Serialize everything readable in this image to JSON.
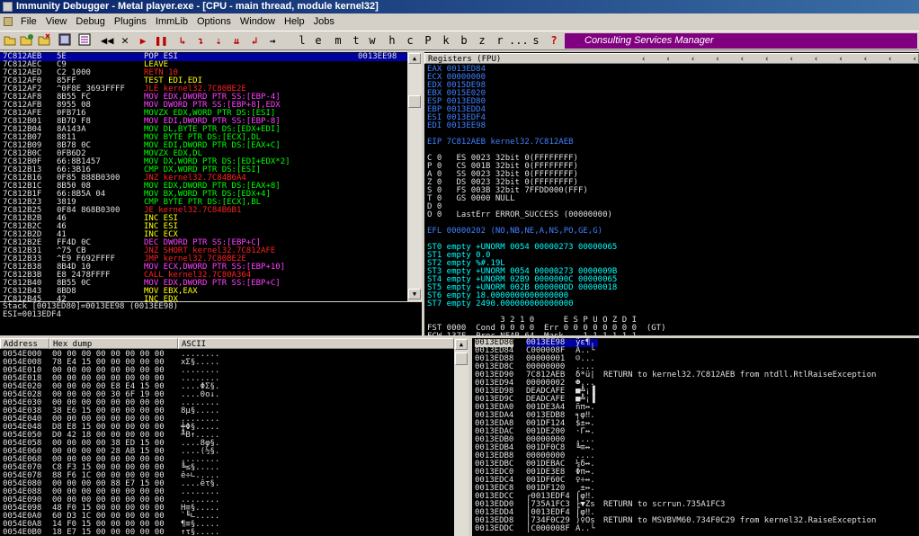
{
  "title": "Immunity Debugger - Metal player.exe - [CPU - main thread, module kernel32]",
  "menu": [
    "File",
    "View",
    "Debug",
    "Plugins",
    "ImmLib",
    "Options",
    "Window",
    "Help",
    "Jobs"
  ],
  "toolbar_letters": [
    "l",
    "e",
    "m",
    "t",
    "w",
    "h",
    "c",
    "P",
    "k",
    "b",
    "z",
    "r",
    "...",
    "s",
    "?"
  ],
  "consulting": "Consulting Services Manager",
  "disasm": [
    {
      "a": "7C812AEB",
      "h": "5E",
      "i": "POP ESI",
      "c": "w",
      "sel": true,
      "r": "0013EE98"
    },
    {
      "a": "7C812AEC",
      "h": "C9",
      "i": "LEAVE",
      "c": "y"
    },
    {
      "a": "7C812AED",
      "h": "C2 1000",
      "i": "RETN 10",
      "c": "r"
    },
    {
      "a": "7C812AF0",
      "h": "85FF",
      "i": "TEST EDI,EDI",
      "c": "y"
    },
    {
      "a": "7C812AF2",
      "h": "^0F8E 3693FFFF",
      "i": "JLE kernel32.7C80BE2E",
      "c": "r"
    },
    {
      "a": "7C812AF8",
      "h": "8B55 FC",
      "i": "MOV EDX,DWORD PTR SS:[EBP-4]",
      "c": "m"
    },
    {
      "a": "7C812AFB",
      "h": "8955 08",
      "i": "MOV DWORD PTR SS:[EBP+8],EDX",
      "c": "m"
    },
    {
      "a": "7C812AFE",
      "h": "0FB716",
      "i": "MOVZX EDX,WORD PTR DS:[ESI]",
      "c": "g"
    },
    {
      "a": "7C812B01",
      "h": "8B7D F8",
      "i": "MOV EDI,DWORD PTR SS:[EBP-8]",
      "c": "m"
    },
    {
      "a": "7C812B04",
      "h": "8A143A",
      "i": "MOV DL,BYTE PTR DS:[EDX+EDI]",
      "c": "g"
    },
    {
      "a": "7C812B07",
      "h": "8811",
      "i": "MOV BYTE PTR DS:[ECX],DL",
      "c": "g"
    },
    {
      "a": "7C812B09",
      "h": "8B78 0C",
      "i": "MOV EDI,DWORD PTR DS:[EAX+C]",
      "c": "g"
    },
    {
      "a": "7C812B0C",
      "h": "0FB6D2",
      "i": "MOVZX EDX,DL",
      "c": "g"
    },
    {
      "a": "7C812B0F",
      "h": "66:8B1457",
      "i": "MOV DX,WORD PTR DS:[EDI+EDX*2]",
      "c": "g"
    },
    {
      "a": "7C812B13",
      "h": "66:3B16",
      "i": "CMP DX,WORD PTR DS:[ESI]",
      "c": "g"
    },
    {
      "a": "7C812B16",
      "h": "0F85 888B0300",
      "i": "JNZ kernel32.7C84B6A4",
      "c": "r"
    },
    {
      "a": "7C812B1C",
      "h": "8B50 08",
      "i": "MOV EDX,DWORD PTR DS:[EAX+8]",
      "c": "g"
    },
    {
      "a": "7C812B1F",
      "h": "66:8B5A 04",
      "i": "MOV BX,WORD PTR DS:[EDX+4]",
      "c": "g"
    },
    {
      "a": "7C812B23",
      "h": "3819",
      "i": "CMP BYTE PTR DS:[ECX],BL",
      "c": "g"
    },
    {
      "a": "7C812B25",
      "h": "0F84 868B0300",
      "i": "JE kernel32.7C84B6B1",
      "c": "r"
    },
    {
      "a": "7C812B2B",
      "h": "46",
      "i": "INC ESI",
      "c": "y"
    },
    {
      "a": "7C812B2C",
      "h": "46",
      "i": "INC ESI",
      "c": "y"
    },
    {
      "a": "7C812B2D",
      "h": "41",
      "i": "INC ECX",
      "c": "y"
    },
    {
      "a": "7C812B2E",
      "h": "FF4D 0C",
      "i": "DEC DWORD PTR SS:[EBP+C]",
      "c": "m"
    },
    {
      "a": "7C812B31",
      "h": "^75 CB",
      "i": "JNZ SHORT kernel32.7C812AFE",
      "c": "r"
    },
    {
      "a": "7C812B33",
      "h": "^E9 F692FFFF",
      "i": "JMP kernel32.7C80BE2E",
      "c": "r"
    },
    {
      "a": "7C812B38",
      "h": "8B4D 10",
      "i": "MOV ECX,DWORD PTR SS:[EBP+10]",
      "c": "m"
    },
    {
      "a": "7C812B3B",
      "h": "E8 2478FFFF",
      "i": "CALL kernel32.7C80A364",
      "c": "r"
    },
    {
      "a": "7C812B40",
      "h": "8B55 0C",
      "i": "MOV EDX,DWORD PTR SS:[EBP+C]",
      "c": "m"
    },
    {
      "a": "7C812B43",
      "h": "8BD8",
      "i": "MOV EBX,EAX",
      "c": "y"
    },
    {
      "a": "7C812B45",
      "h": "42",
      "i": "INC EDX",
      "c": "y"
    }
  ],
  "info": [
    "Stack [0013ED80]=0013EE98 (0013EE98)",
    "ESI=0013EDF4"
  ],
  "registers": {
    "title": "Registers (FPU)",
    "lines": [
      "EAX 0013ED84",
      "ECX 00000000",
      "EDX 0015DE98",
      "EBX 0015E020",
      "ESP 0013ED80",
      "EBP 0013EDD4",
      "ESI 0013EDF4",
      "EDI 0013EE98",
      "",
      "EIP 7C812AEB kernel32.7C812AEB",
      "",
      "C 0   ES 0023 32bit 0(FFFFFFFF)",
      "P 0   CS 001B 32bit 0(FFFFFFFF)",
      "A 0   SS 0023 32bit 0(FFFFFFFF)",
      "Z 0   DS 0023 32bit 0(FFFFFFFF)",
      "S 0   FS 003B 32bit 7FFDD000(FFF)",
      "T 0   GS 0000 NULL",
      "D 0",
      "O 0   LastErr ERROR_SUCCESS (00000000)",
      "",
      "EFL 00000202 (NO,NB,NE,A,NS,PO,GE,G)",
      "",
      "ST0 empty +UNORM 0054 00000273 00000065",
      "ST1 empty 0.0",
      "ST2 empty %#.19L",
      "ST3 empty +UNORM 0054 00000273 0000009B",
      "ST4 empty +UNORM 02B9 0000000C 00000065",
      "ST5 empty +UNORM 002B 000000DD 00000018",
      "ST6 empty 18.0000000000000000",
      "ST7 empty 2490.000000000000000",
      "",
      "               3 2 1 0      E S P U O Z D I",
      "FST 0000  Cond 0 0 0 0  Err 0 0 0 0 0 0 0 0  (GT)",
      "FCW 137F  Prec NEAR,64  Mask    1 1 1 1 1 1"
    ]
  },
  "dump_headers": [
    "Address",
    "Hex dump",
    "ASCII"
  ],
  "dump": [
    [
      "0054E000",
      "00 00 00 00 00 00 00 00",
      "........"
    ],
    [
      "0054E008",
      "78 E4 15 00 00 00 00 00",
      "xΣ§....."
    ],
    [
      "0054E010",
      "00 00 00 00 00 00 00 00",
      "........"
    ],
    [
      "0054E018",
      "00 00 00 00 00 00 00 00",
      "........"
    ],
    [
      "0054E020",
      "00 00 00 00 E8 E4 15 00",
      "....ΦΣ§."
    ],
    [
      "0054E028",
      "00 00 00 00 30 6F 19 00",
      "....0o↓."
    ],
    [
      "0054E030",
      "00 00 00 00 00 00 00 00",
      "........"
    ],
    [
      "0054E038",
      "38 E6 15 00 00 00 00 00",
      "8µ§....."
    ],
    [
      "0054E040",
      "00 00 00 00 00 00 00 00",
      "........"
    ],
    [
      "0054E048",
      "D8 E8 15 00 00 00 00 00",
      "╪Φ§....."
    ],
    [
      "0054E050",
      "D0 42 18 00 00 00 00 00",
      "╨B↑....."
    ],
    [
      "0054E058",
      "00 00 00 00 38 ED 15 00",
      "....8φ§."
    ],
    [
      "0054E060",
      "00 00 00 00 28 AB 15 00",
      "....(½§."
    ],
    [
      "0054E068",
      "00 00 00 00 00 00 00 00",
      "........"
    ],
    [
      "0054E070",
      "C8 F3 15 00 00 00 00 00",
      "╚≤§....."
    ],
    [
      "0054E078",
      "88 F6 1C 00 00 00 00 00",
      "ê÷∟....."
    ],
    [
      "0054E080",
      "00 00 00 00 88 E7 15 00",
      "....êτ§."
    ],
    [
      "0054E088",
      "00 00 00 00 00 00 00 00",
      "........"
    ],
    [
      "0054E090",
      "00 00 00 00 00 00 00 00",
      "........"
    ],
    [
      "0054E098",
      "48 F0 15 00 00 00 00 00",
      "H≡§....."
    ],
    [
      "0054E0A0",
      "60 D3 1C 00 00 00 00 00",
      "`╙∟....."
    ],
    [
      "0054E0A8",
      "14 F0 15 00 00 00 00 00",
      "¶≡§....."
    ],
    [
      "0054E0B0",
      "18 E7 15 00 00 00 00 00",
      "↑τ§....."
    ]
  ],
  "stack": [
    [
      "0013ED80",
      "0013EE98",
      "ÿε¶.",
      ""
    ],
    [
      "0013ED84",
      "C000008F",
      "A..└",
      ""
    ],
    [
      "0013ED88",
      "00000001",
      "☺...",
      ""
    ],
    [
      "0013ED8C",
      "00000000",
      "....",
      ""
    ],
    [
      "0013ED90",
      "7C812AEB",
      "δ*ü|",
      "RETURN to kernel32.7C812AEB from ntdll.RtlRaiseException"
    ],
    [
      "0013ED94",
      "00000002",
      "☻...",
      ""
    ],
    [
      "0013ED98",
      "DEADCAFE",
      "■╩¡▐",
      ""
    ],
    [
      "0013ED9C",
      "DEADCAFE",
      "■╩¡▐",
      ""
    ],
    [
      "0013EDA0",
      "001DE3A4",
      "ñπ↔.",
      ""
    ],
    [
      "0013EDA4",
      "0013EDB8",
      "╕φ‼.",
      ""
    ],
    [
      "0013EDA8",
      "001DF124",
      "$±↔.",
      ""
    ],
    [
      "0013EDAC",
      "001DE200",
      "·Γ↔.",
      ""
    ],
    [
      "0013EDB0",
      "00000000",
      "....",
      ""
    ],
    [
      "0013EDB4",
      "001DF0C8",
      "╚≡↔.",
      ""
    ],
    [
      "0013EDB8",
      "00000000",
      "....",
      ""
    ],
    [
      "0013EDBC",
      "001DEBAC",
      "¼δ↔.",
      ""
    ],
    [
      "0013EDC0",
      "001DE3E8",
      "Φπ↔.",
      ""
    ],
    [
      "0013EDC4",
      "001DF60C",
      "♀÷↔.",
      ""
    ],
    [
      "0013EDC8",
      "001DF120",
      " ±↔.",
      ""
    ],
    [
      "0013EDCC",
      "┌0013EDF4",
      "⌠φ‼.",
      ""
    ],
    [
      "0013EDD0",
      "│735A1FC3",
      "├▼Zs",
      "RETURN to scrrun.735A1FC3"
    ],
    [
      "0013EDD4",
      "│0013EDF4",
      "⌠φ‼.",
      ""
    ],
    [
      "0013EDD8",
      "│734F0C29",
      ")♀Os",
      "RETURN to MSVBVM60.734F0C29 from kernel32.RaiseException"
    ],
    [
      "0013EDDC",
      "│C000008F",
      "A..└",
      ""
    ]
  ]
}
